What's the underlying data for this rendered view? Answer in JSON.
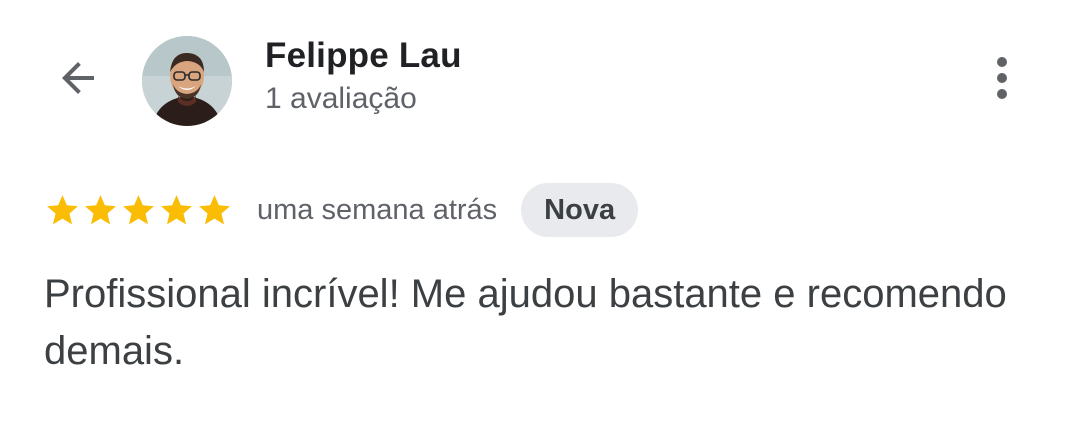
{
  "header": {
    "back_icon": "arrow-left-icon",
    "more_icon": "more-vert-icon"
  },
  "reviewer": {
    "name": "Felippe Lau",
    "review_count": "1 avaliação",
    "avatar_icon": "profile-photo"
  },
  "review": {
    "rating": 5,
    "max_rating": 5,
    "star_color": "#fbbc04",
    "time_ago": "uma semana atrás",
    "badge": "Nova",
    "text": "Profissional incrível! Me ajudou bastante e recomendo demais."
  }
}
